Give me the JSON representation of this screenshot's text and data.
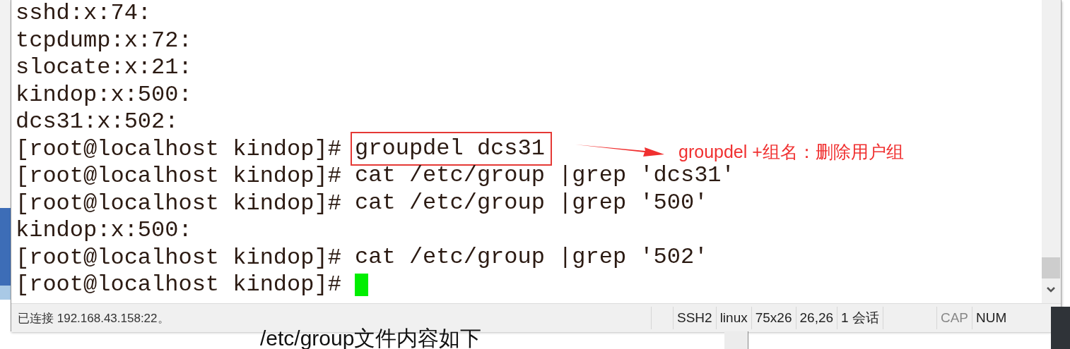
{
  "terminal": {
    "lines": [
      {
        "kind": "output",
        "text": "sshd:x:74:"
      },
      {
        "kind": "output",
        "text": "tcpdump:x:72:"
      },
      {
        "kind": "output",
        "text": "slocate:x:21:"
      },
      {
        "kind": "output",
        "text": "kindop:x:500:"
      },
      {
        "kind": "output",
        "text": "dcs31:x:502:"
      },
      {
        "kind": "prompt",
        "prompt": "[root@localhost kindop]# ",
        "command": "groupdel dcs31",
        "highlighted": true
      },
      {
        "kind": "prompt",
        "prompt": "[root@localhost kindop]# ",
        "command": "cat /etc/group |grep 'dcs31'",
        "highlighted": false
      },
      {
        "kind": "prompt",
        "prompt": "[root@localhost kindop]# ",
        "command": "cat /etc/group |grep '500'",
        "highlighted": false
      },
      {
        "kind": "output",
        "text": "kindop:x:500:"
      },
      {
        "kind": "prompt",
        "prompt": "[root@localhost kindop]# ",
        "command": "cat /etc/group |grep '502'",
        "highlighted": false
      },
      {
        "kind": "input",
        "prompt": "[root@localhost kindop]# ",
        "cursor": true
      }
    ]
  },
  "annotation": {
    "text": "groupdel +组名：删除用户组"
  },
  "status_bar": {
    "message": "已连接 192.168.43.158:22。",
    "fields": [
      {
        "text": "SSH2",
        "disabled": false
      },
      {
        "text": "linux",
        "disabled": false
      },
      {
        "text": "75x26",
        "disabled": false
      },
      {
        "text": "26,26",
        "disabled": false
      },
      {
        "text": "1 会话",
        "disabled": false
      },
      {
        "text": "CAP",
        "disabled": true
      },
      {
        "text": "NUM",
        "disabled": false
      }
    ]
  },
  "background_document": {
    "text": "/etc/group文件内容如下"
  }
}
